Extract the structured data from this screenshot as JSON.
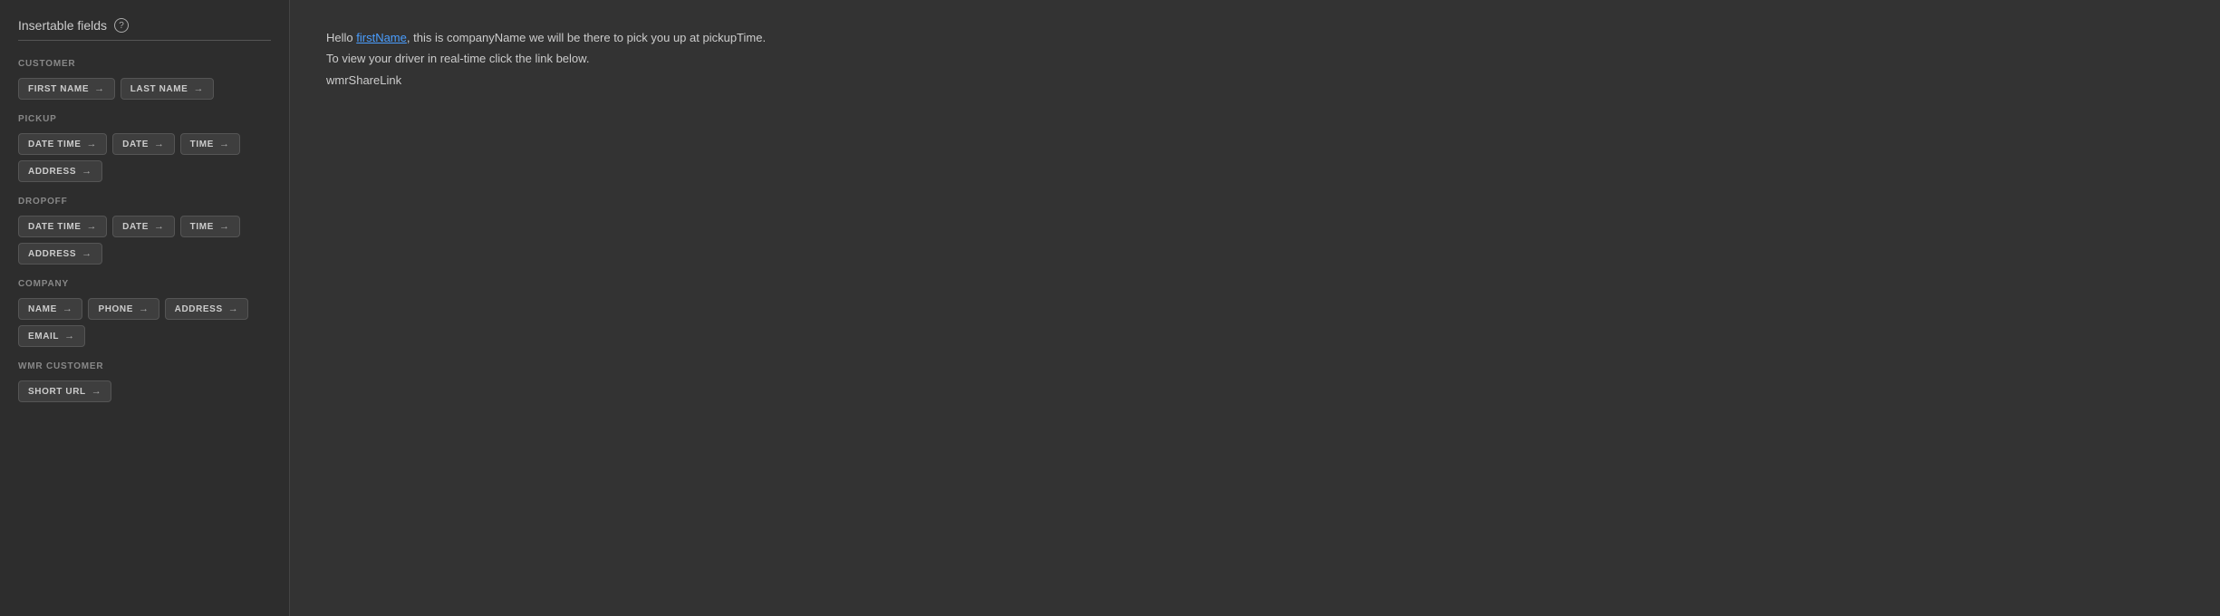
{
  "leftPanel": {
    "title": "Insertable fields",
    "helpIcon": "?",
    "sections": [
      {
        "id": "customer",
        "label": "CUSTOMER",
        "rows": [
          [
            {
              "id": "first-name",
              "label": "FIRST NAME"
            },
            {
              "id": "last-name",
              "label": "LAST NAME"
            }
          ]
        ]
      },
      {
        "id": "pickup",
        "label": "PICKUP",
        "rows": [
          [
            {
              "id": "pickup-date-time",
              "label": "DATE TIME"
            },
            {
              "id": "pickup-date",
              "label": "DATE"
            },
            {
              "id": "pickup-time",
              "label": "TIME"
            }
          ],
          [
            {
              "id": "pickup-address",
              "label": "ADDRESS"
            }
          ]
        ]
      },
      {
        "id": "dropoff",
        "label": "DROPOFF",
        "rows": [
          [
            {
              "id": "dropoff-date-time",
              "label": "DATE TIME"
            },
            {
              "id": "dropoff-date",
              "label": "DATE"
            },
            {
              "id": "dropoff-time",
              "label": "TIME"
            }
          ],
          [
            {
              "id": "dropoff-address",
              "label": "ADDRESS"
            }
          ]
        ]
      },
      {
        "id": "company",
        "label": "COMPANY",
        "rows": [
          [
            {
              "id": "company-name",
              "label": "NAME"
            },
            {
              "id": "company-phone",
              "label": "PHONE"
            },
            {
              "id": "company-address",
              "label": "ADDRESS"
            }
          ],
          [
            {
              "id": "company-email",
              "label": "EMAIL"
            }
          ]
        ]
      },
      {
        "id": "wmr-customer",
        "label": "WMR CUSTOMER",
        "rows": [
          [
            {
              "id": "short-url",
              "label": "SHORT URL"
            }
          ]
        ]
      }
    ]
  },
  "rightPanel": {
    "line1": "Hello firstName, this is companyName we will be there to pick you up at pickupTime.",
    "line1_highlight": "firstName",
    "line2": "To view your driver in real-time click the link below.",
    "line3": "wmrShareLink"
  }
}
